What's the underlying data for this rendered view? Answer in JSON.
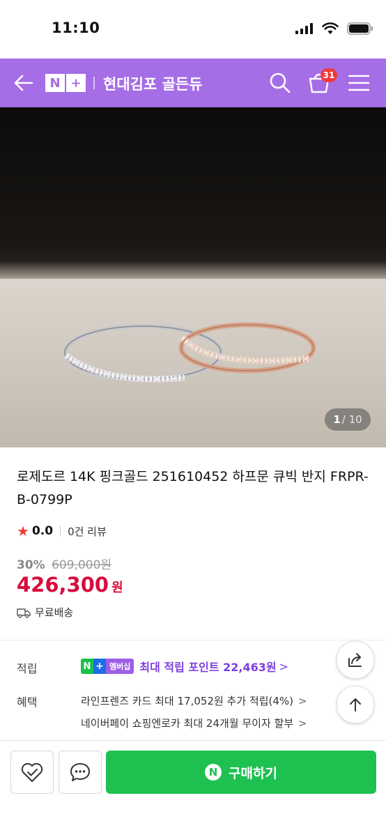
{
  "status": {
    "time": "11:10"
  },
  "header": {
    "logo_left": "N",
    "logo_right": "+",
    "store_name": "현대김포 골든듀",
    "cart_count": "31",
    "brand_color": "#a56de6"
  },
  "gallery": {
    "current": "1",
    "total": "/ 10"
  },
  "product": {
    "title": "로제도르 14K 핑크골드 251610452 하프문 큐빅 반지 FRPR-B-0799P",
    "rating_star": "★",
    "rating": "0.0",
    "review_count": "0건 리뷰",
    "discount": "30%",
    "original_price": "609,000원",
    "price": "426,300",
    "price_unit": "원",
    "shipping": "무료배송",
    "price_color": "#d80c3b"
  },
  "benefits": {
    "points_label": "적립",
    "badge_n": "N",
    "badge_plus": "+",
    "badge_text": "멤버십",
    "points_text": "최대 적립 포인트 22,463원",
    "points_arrow": ">",
    "benefit_label": "혜택",
    "lines": [
      "라인프렌즈 카드 최대 17,052원 추가 적립(4%)",
      "네이버페이 쇼핑엔로카 최대 24개월 무이자 할부"
    ],
    "chevron": ">"
  },
  "bottom": {
    "buy_icon": "N",
    "buy_label": "구매하기",
    "buy_color": "#1ec150"
  }
}
